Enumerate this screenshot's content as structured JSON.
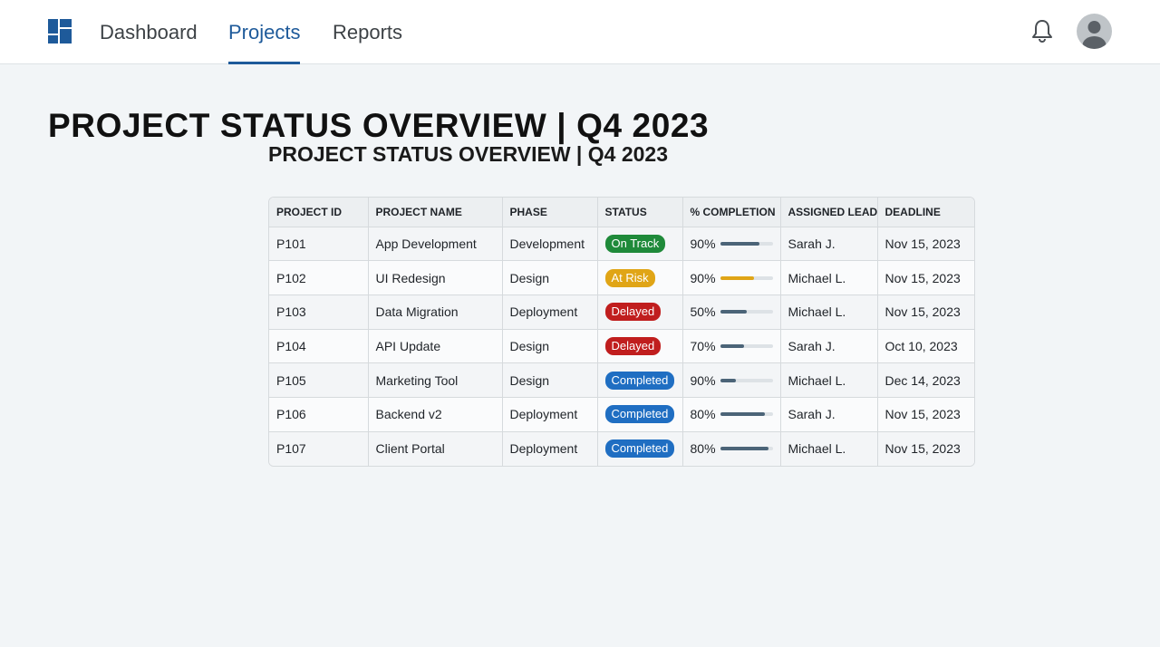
{
  "nav": {
    "tabs": [
      {
        "label": "Dashboard",
        "active": false
      },
      {
        "label": "Projects",
        "active": true
      },
      {
        "label": "Reports",
        "active": false
      }
    ],
    "logo_icon": "dashboard-grid-icon",
    "notification_icon": "bell-icon",
    "avatar_icon": "user-avatar-icon"
  },
  "colors": {
    "accent": "#1e5a9a",
    "on_track": "#1f8a3a",
    "at_risk": "#e0a516",
    "delayed": "#c01e1e",
    "completed": "#1f6ec2"
  },
  "page": {
    "title": "PROJECT STATUS OVERVIEW | Q4 2023",
    "subtitle": "PROJECT STATUS OVERVIEW | Q4 2023"
  },
  "table": {
    "headers": [
      "PROJECT ID",
      "PROJECT NAME",
      "PHASE",
      "STATUS",
      "% COMPLETION",
      "ASSIGNED LEAD",
      "DEADLINE"
    ],
    "rows": [
      {
        "id": "P101",
        "name": "App Development",
        "phase": "Development",
        "status": "On Track",
        "status_type": "ontrack",
        "completion": "90%",
        "progress": 0.75,
        "lead": "Sarah J.",
        "deadline": "Nov 15, 2023"
      },
      {
        "id": "P102",
        "name": "UI Redesign",
        "phase": "Design",
        "status": "At Risk",
        "status_type": "atrisk",
        "completion": "90%",
        "progress": 0.65,
        "lead": "Michael L.",
        "deadline": "Nov 15, 2023"
      },
      {
        "id": "P103",
        "name": "Data Migration",
        "phase": "Deployment",
        "status": "Delayed",
        "status_type": "delayed",
        "completion": "50%",
        "progress": 0.5,
        "lead": "Michael L.",
        "deadline": "Nov 15, 2023"
      },
      {
        "id": "P104",
        "name": "API Update",
        "phase": "Design",
        "status": "Delayed",
        "status_type": "delayed",
        "completion": "70%",
        "progress": 0.45,
        "lead": "Sarah J.",
        "deadline": "Oct 10, 2023"
      },
      {
        "id": "P105",
        "name": "Marketing Tool",
        "phase": "Design",
        "status": "Completed",
        "status_type": "completed",
        "completion": "90%",
        "progress": 0.3,
        "lead": "Michael L.",
        "deadline": "Dec 14, 2023"
      },
      {
        "id": "P106",
        "name": "Backend v2",
        "phase": "Deployment",
        "status": "Completed",
        "status_type": "completed",
        "completion": "80%",
        "progress": 0.85,
        "lead": "Sarah J.",
        "deadline": "Nov 15, 2023"
      },
      {
        "id": "P107",
        "name": "Client Portal",
        "phase": "Deployment",
        "status": "Completed",
        "status_type": "completed",
        "completion": "80%",
        "progress": 0.92,
        "lead": "Michael L.",
        "deadline": "Nov 15, 2023"
      }
    ]
  }
}
